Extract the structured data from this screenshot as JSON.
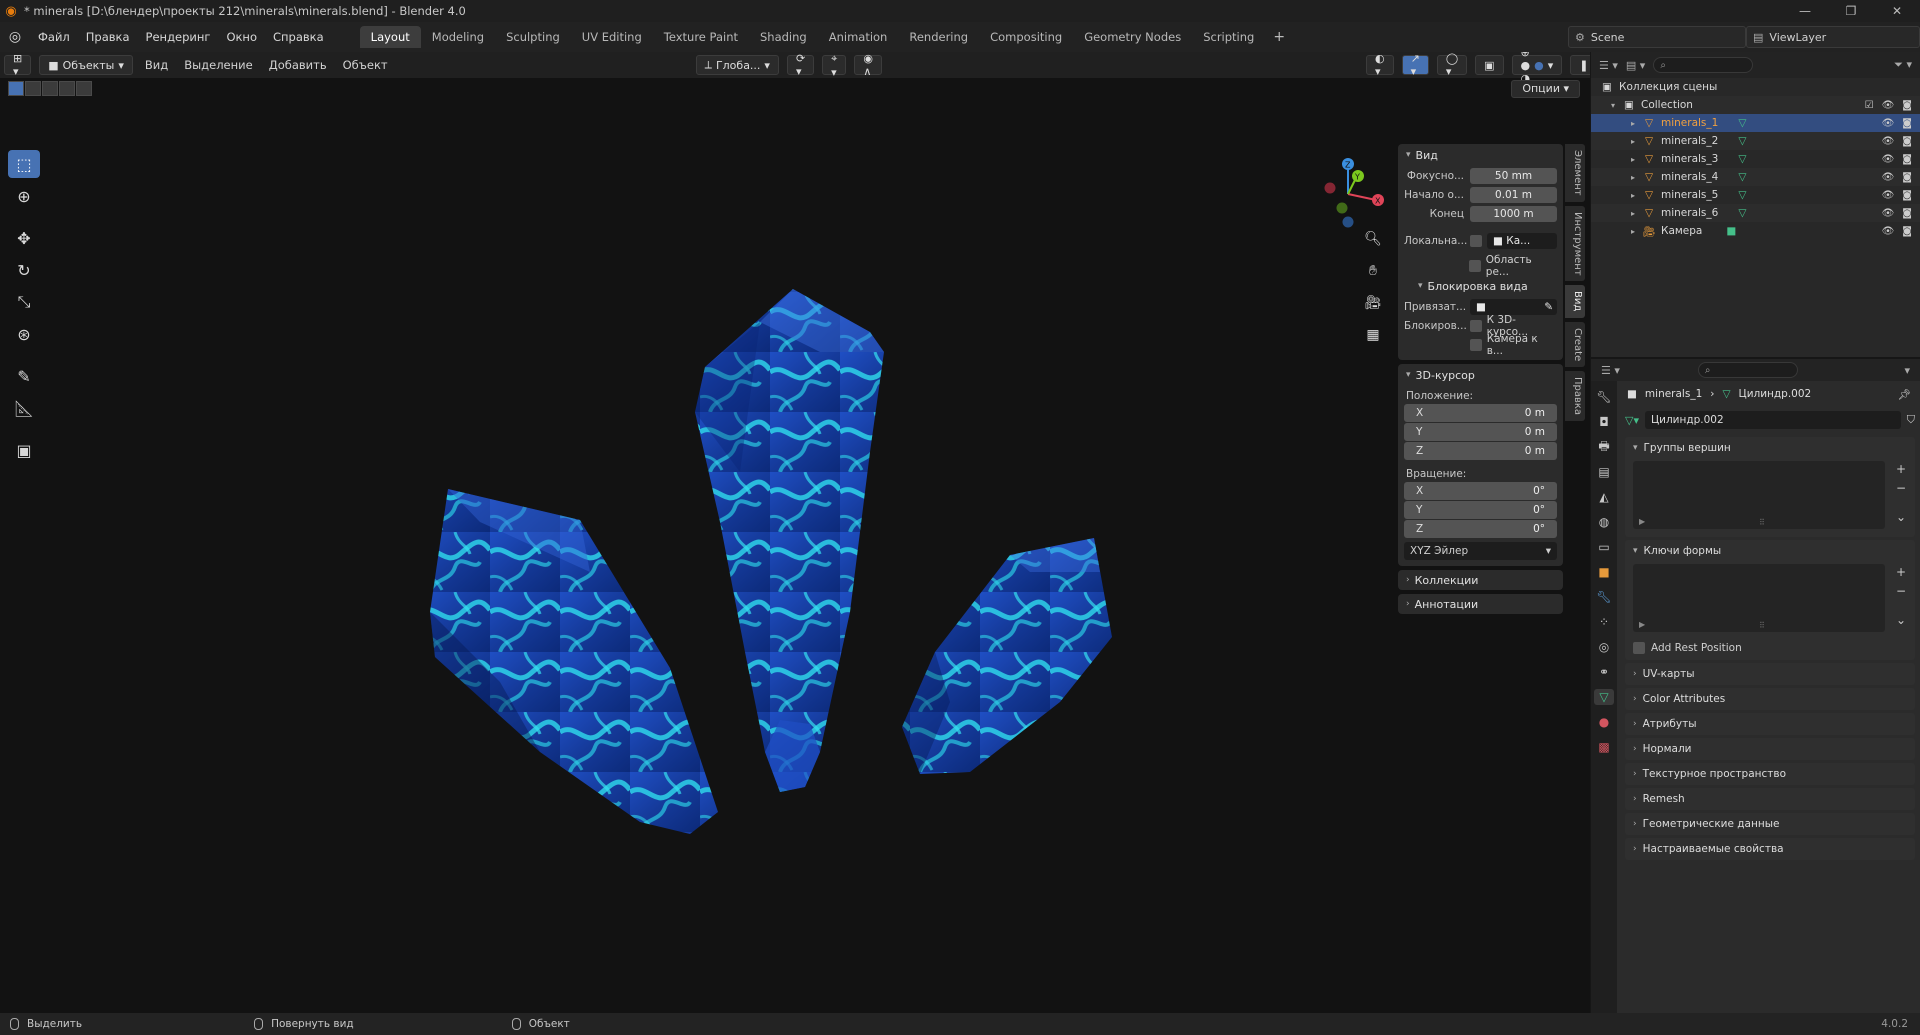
{
  "window": {
    "title": "* minerals [D:\\блендер\\проекты 212\\minerals\\minerals.blend] - Blender 4.0"
  },
  "menu": [
    "Файл",
    "Правка",
    "Рендеринг",
    "Окно",
    "Справка"
  ],
  "workspaces": [
    "Layout",
    "Modeling",
    "Sculpting",
    "UV Editing",
    "Texture Paint",
    "Shading",
    "Animation",
    "Rendering",
    "Compositing",
    "Geometry Nodes",
    "Scripting"
  ],
  "active_workspace": "Layout",
  "scene": {
    "name": "Scene",
    "view_layer": "ViewLayer"
  },
  "viewport": {
    "mode": "Объекты",
    "menus": [
      "Вид",
      "Выделение",
      "Добавить",
      "Объект"
    ],
    "transform_orientation": "Глоба...",
    "options": "Опции"
  },
  "gizmo": {
    "x": "X",
    "y": "Y",
    "z": "Z"
  },
  "npanel": {
    "view": {
      "title": "Вид",
      "focal_label": "Фокусно...",
      "focal_value": "50 mm",
      "clip_start_label": "Начало о...",
      "clip_start_value": "0.01 m",
      "clip_end_label": "Конец",
      "clip_end_value": "1000 m",
      "local_label": "Локальна...",
      "local_value": "Ка...",
      "region_label": "Область ре..."
    },
    "lock": {
      "title": "Блокировка вида",
      "bind_label": "Привязат...",
      "lock_label": "Блокиров...",
      "to_cursor": "К 3D-курсо...",
      "camera_to_view": "Камера к в..."
    },
    "cursor": {
      "title": "3D-курсор",
      "location_label": "Положение:",
      "loc": [
        {
          "axis": "X",
          "value": "0 m"
        },
        {
          "axis": "Y",
          "value": "0 m"
        },
        {
          "axis": "Z",
          "value": "0 m"
        }
      ],
      "rotation_label": "Вращение:",
      "rot": [
        {
          "axis": "X",
          "value": "0°"
        },
        {
          "axis": "Y",
          "value": "0°"
        },
        {
          "axis": "Z",
          "value": "0°"
        }
      ],
      "rotation_mode": "XYZ Эйлер"
    },
    "collections": "Коллекции",
    "annotations": "Аннотации"
  },
  "vtabs": [
    "Элемент",
    "Инструмент",
    "Вид",
    "Create",
    "Правка"
  ],
  "outliner": {
    "scene_collection": "Коллекция сцены",
    "collection": "Collection",
    "items": [
      "minerals_1",
      "minerals_2",
      "minerals_3",
      "minerals_4",
      "minerals_5",
      "minerals_6"
    ],
    "camera": "Камера"
  },
  "properties": {
    "object_name": "minerals_1",
    "mesh_name": "Цилиндр.002",
    "panels": {
      "vertex_groups": "Группы вершин",
      "shape_keys": "Ключи формы",
      "add_rest_position": "Add Rest Position"
    },
    "collapsed": [
      "UV-карты",
      "Color Attributes",
      "Атрибуты",
      "Нормали",
      "Текстурное пространство",
      "Remesh",
      "Геометрические данные",
      "Настраиваемые свойства"
    ]
  },
  "status": {
    "select": "Выделить",
    "rotate": "Повернуть вид",
    "object": "Объект",
    "version": "4.0.2"
  },
  "colors": {
    "accent": "#4772b3",
    "selection": "#334d80",
    "crystal_dark": "#0c2a7a",
    "crystal_mid": "#1f4fc4",
    "crystal_glow": "#2ed3e8",
    "axis_x": "#e04458",
    "axis_y": "#7cc81e",
    "axis_z": "#3a8fe0"
  }
}
